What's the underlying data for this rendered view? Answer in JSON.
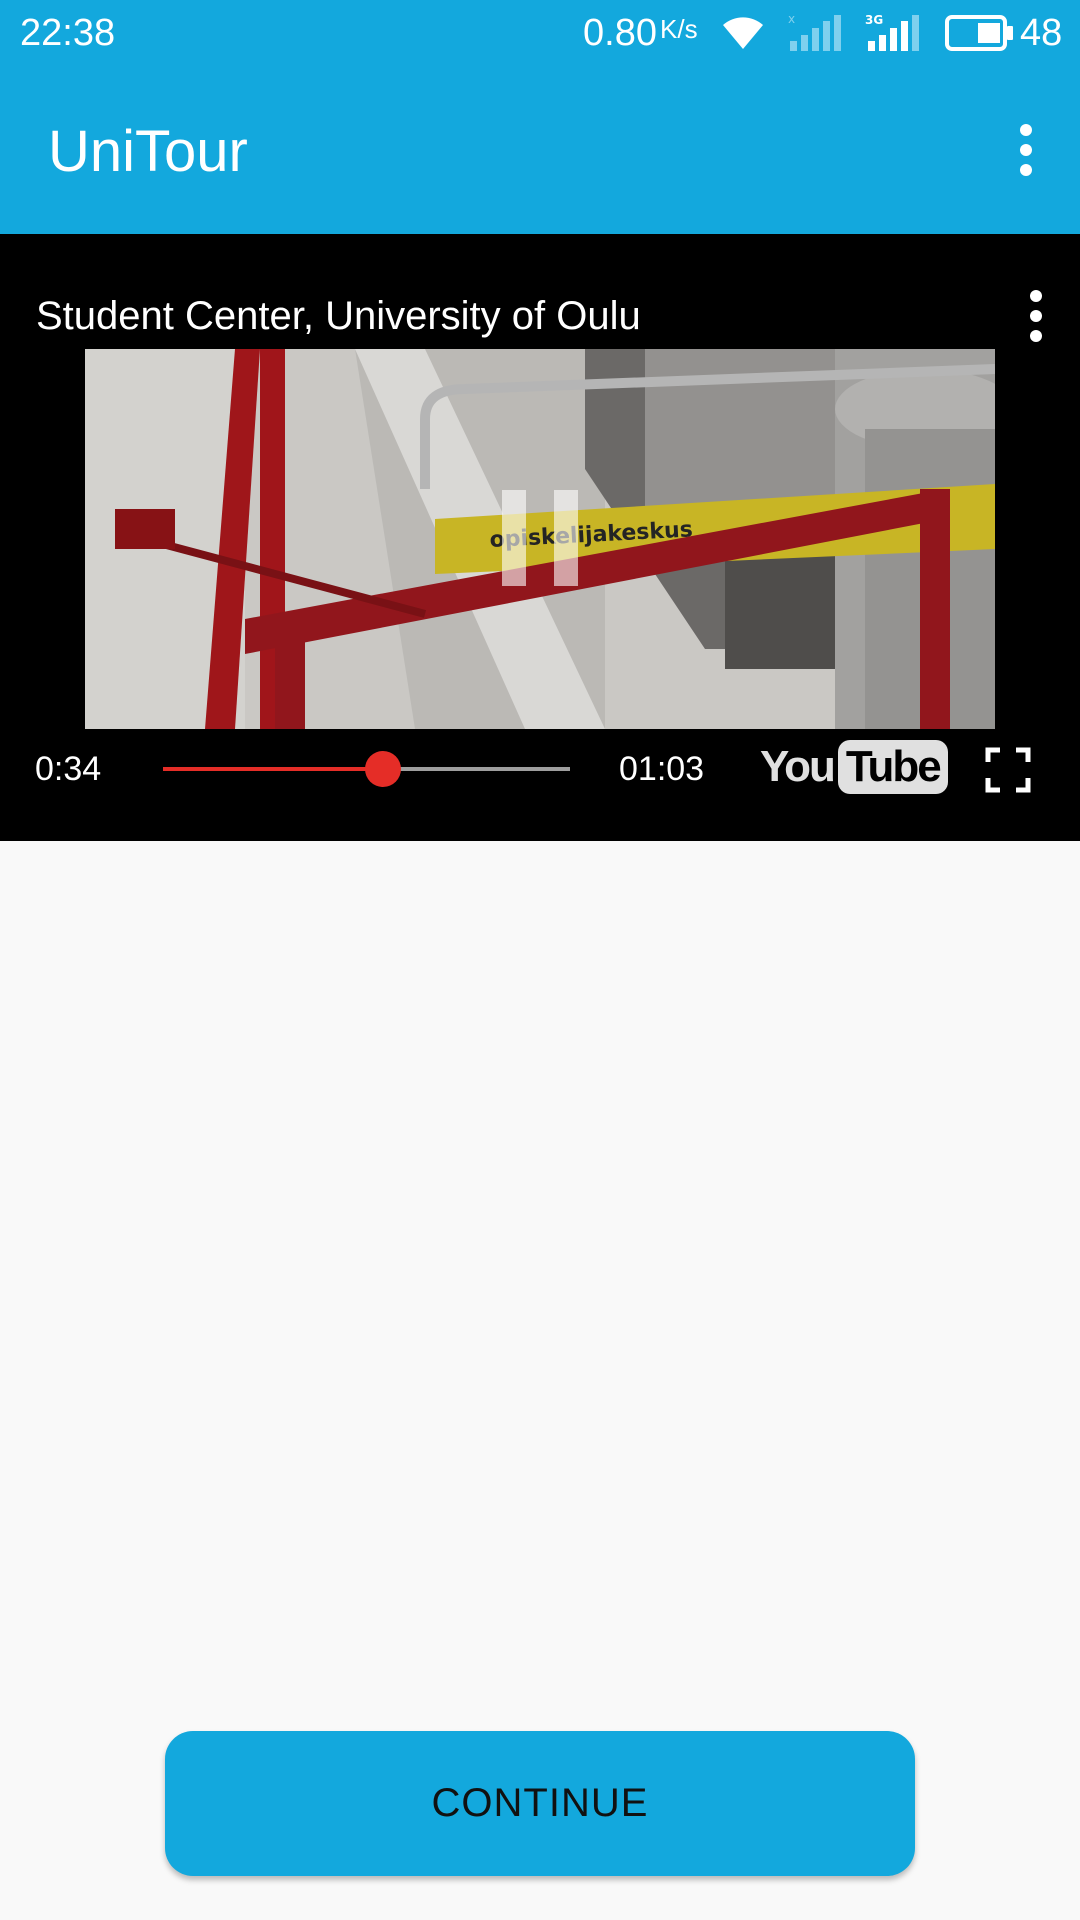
{
  "status_bar": {
    "time": "22:38",
    "network_speed": "0.80",
    "network_speed_unit": "K/s",
    "battery_level": "48",
    "icons": [
      "wifi-icon",
      "signal-sim1-icon",
      "signal-3g-icon",
      "battery-icon"
    ],
    "network_type": "3G"
  },
  "app_bar": {
    "title": "UniTour",
    "overflow_icon": "more-vert-icon"
  },
  "player": {
    "video_title": "Student Center, University of Oulu",
    "current_time": "0:34",
    "total_time": "01:03",
    "progress": 0.54,
    "state": "playing",
    "logo_you": "You",
    "logo_tube": "Tube",
    "sign_text": "opiskelijakeskus",
    "colors": {
      "progress": "#e52d27",
      "track": "#9e9e9e"
    }
  },
  "actions": {
    "continue_label": "CONTINUE"
  },
  "colors": {
    "primary": "#13a8dd",
    "background": "#f9f9f9"
  }
}
